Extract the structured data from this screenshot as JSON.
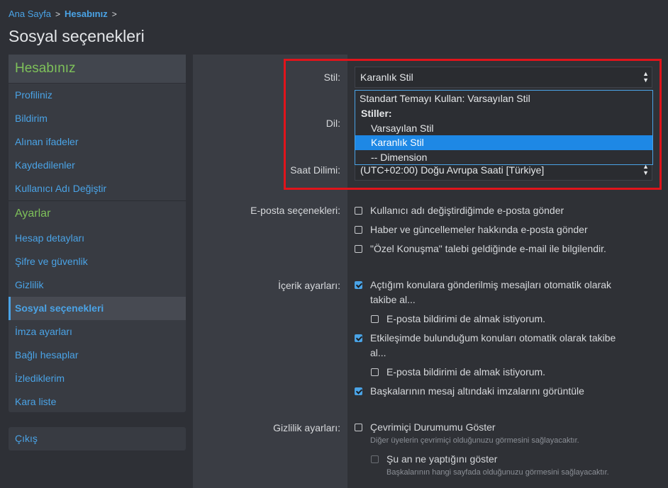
{
  "breadcrumb": {
    "home": "Ana Sayfa",
    "current": "Hesabınız",
    "sep": ">"
  },
  "page_title": "Sosyal seçenekleri",
  "sidebar": {
    "section1": "Hesabınız",
    "items1": [
      "Profiliniz",
      "Bildirim",
      "Alınan ifadeler",
      "Kaydedilenler",
      "Kullanıcı Adı Değiştir"
    ],
    "section2": "Ayarlar",
    "items2": [
      "Hesap detayları",
      "Şifre ve güvenlik",
      "Gizlilik",
      "Sosyal seçenekleri",
      "İmza ayarları",
      "Bağlı hesaplar",
      "İzlediklerim",
      "Kara liste"
    ],
    "active": "Sosyal seçenekleri",
    "logout": "Çıkış"
  },
  "form": {
    "style_label": "Stil:",
    "style_value": "Karanlık Stil",
    "language_label": "Dil:",
    "timezone_label": "Saat Dilimi:",
    "timezone_value": "(UTC+02:00) Doğu Avrupa Saati [Türkiye]",
    "dropdown_options": [
      {
        "label": "Standart Temayı Kullan: Varsayılan Stil",
        "kind": "option"
      },
      {
        "label": "Stiller:",
        "kind": "group"
      },
      {
        "label": "Varsayılan Stil",
        "kind": "option"
      },
      {
        "label": "Karanlık Stil",
        "kind": "selected"
      },
      {
        "label": "-- Dimension",
        "kind": "option"
      }
    ],
    "email_label": "E-posta seçenekleri:",
    "email_options": [
      {
        "label": "Kullanıcı adı değiştirdiğimde e-posta gönder",
        "checked": false
      },
      {
        "label": "Haber ve güncellemeler hakkında e-posta gönder",
        "checked": false
      },
      {
        "label": "\"Özel Konuşma\" talebi geldiğinde e-mail ile bilgilendir.",
        "checked": false
      }
    ],
    "content_label": "İçerik ayarları:",
    "content_options": {
      "watch_created_l1": "Açtığım konulara gönderilmiş mesajları otomatik olarak",
      "watch_created_l2": "takibe al...",
      "email_notify_1": "E-posta bildirimi de almak istiyorum.",
      "watch_interacted_l1": "Etkileşimde bulunduğum konuları otomatik olarak takibe",
      "watch_interacted_l2": "al...",
      "email_notify_2": "E-posta bildirimi de almak istiyorum.",
      "show_signatures": "Başkalarının mesaj altındaki imzalarını görüntüle"
    },
    "privacy_label": "Gizlilik ayarları:",
    "privacy_options": {
      "show_online": "Çevrimiçi Durumumu Göster",
      "show_online_hint": "Diğer üyelerin çevrimiçi olduğunuzu görmesini sağlayacaktır.",
      "show_activity": "Şu an ne yaptığını göster",
      "show_activity_hint": "Başkalarının hangi sayfada olduğunuzu görmesini sağlayacaktır."
    }
  },
  "colors": {
    "accent": "#4aa3e6",
    "section": "#7ec15a",
    "highlight": "#e0141b",
    "selected": "#1e88e5"
  }
}
